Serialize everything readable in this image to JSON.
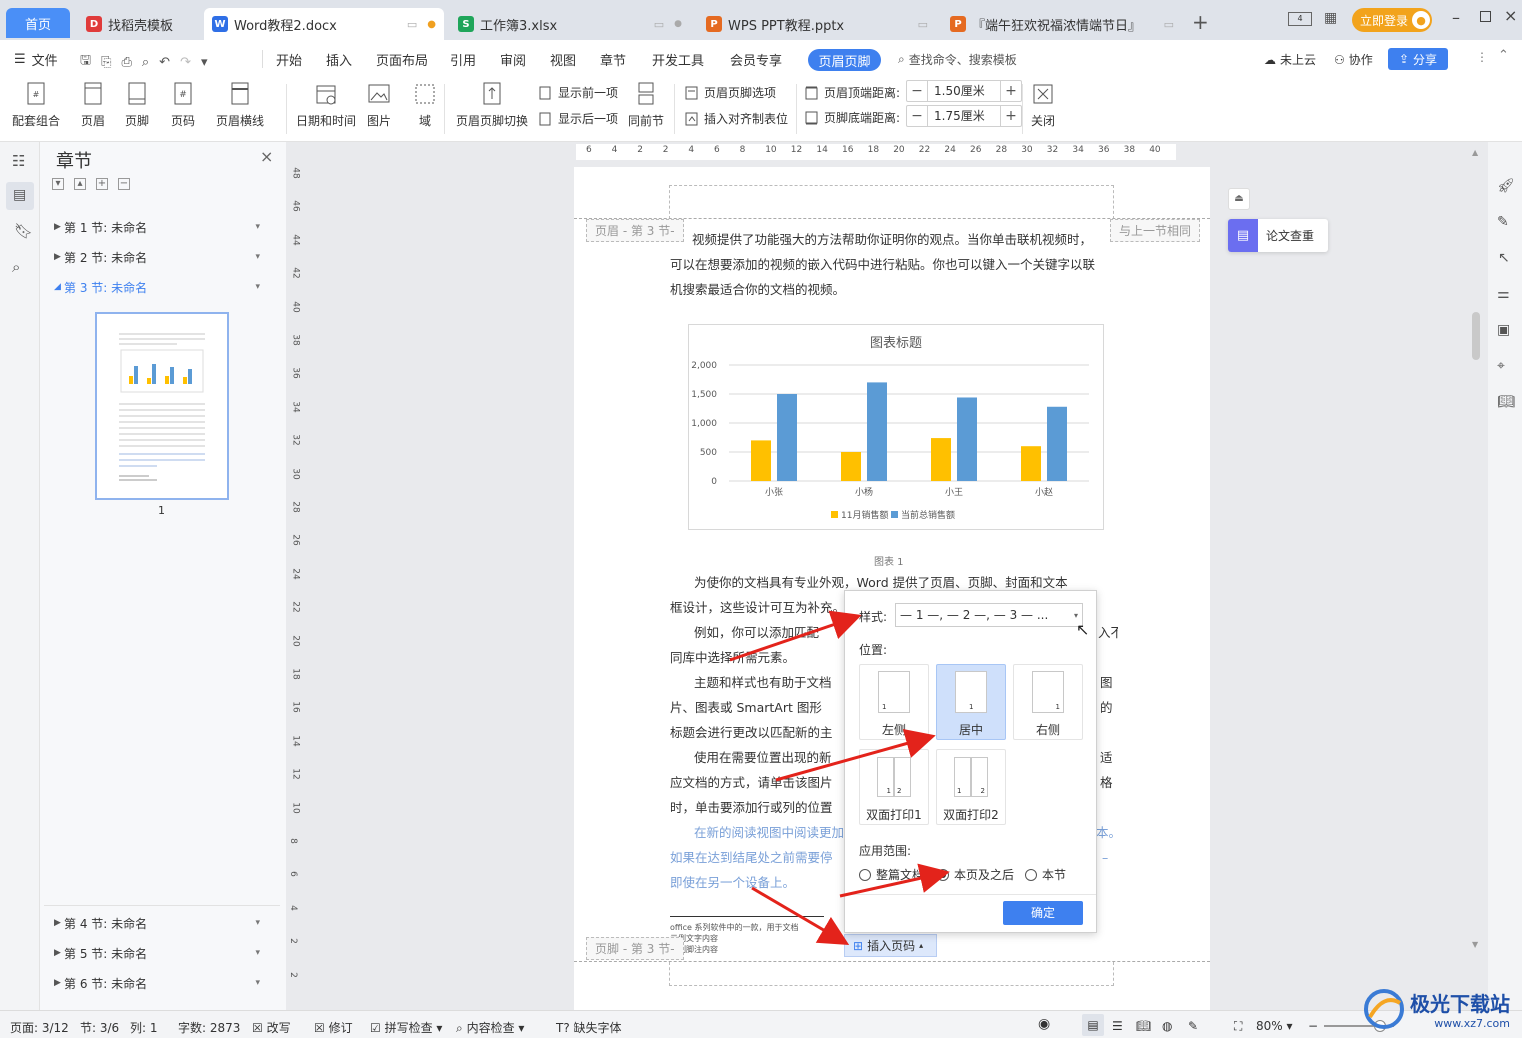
{
  "tabs": {
    "home": "首页",
    "items": [
      {
        "label": "找稻壳模板",
        "icon_color": "#e03b3b",
        "icon": "D"
      },
      {
        "label": "Word教程2.docx",
        "icon_color": "#2f6fe6",
        "icon": "W"
      },
      {
        "label": "工作簿3.xlsx",
        "icon_color": "#1fa55a",
        "icon": "S"
      },
      {
        "label": "WPS PPT教程.pptx",
        "icon_color": "#e56a21",
        "icon": "P"
      },
      {
        "label": "『端午狂欢祝福浓情端节日』",
        "icon_color": "#e56a21",
        "icon": "P"
      }
    ],
    "login": "立即登录"
  },
  "menu": {
    "file": "文件",
    "items": [
      "开始",
      "插入",
      "页面布局",
      "引用",
      "审阅",
      "视图",
      "章节",
      "开发工具",
      "会员专享"
    ],
    "active": "页眉页脚",
    "search": "查找命令、搜索模板",
    "cloud": "未上云",
    "collab": "协作",
    "share": "分享"
  },
  "ribbon": {
    "combo": "配套组合",
    "header": "页眉",
    "footer": "页脚",
    "page_number": "页码",
    "header_line": "页眉横线",
    "datetime": "日期和时间",
    "picture": "图片",
    "field": "域",
    "switch": "页眉页脚切换",
    "show_prev": "显示前一项",
    "show_next": "显示后一项",
    "same_prev": "同前节",
    "options": "页眉页脚选项",
    "insert_tab": "插入对齐制表位",
    "top_dist_label": "页眉顶端距离:",
    "top_dist": "1.50厘米",
    "bottom_dist_label": "页脚底端距离:",
    "bottom_dist": "1.75厘米",
    "close": "关闭"
  },
  "chapter_pane": {
    "title": "章节",
    "sections": [
      "第 1 节: 未命名",
      "第 2 节: 未命名",
      "第 3 节: 未命名",
      "第 4 节: 未命名",
      "第 5 节: 未命名",
      "第 6 节: 未命名"
    ],
    "thumb_page": "1"
  },
  "ruler": {
    "h_ticks": [
      "6",
      "4",
      "2",
      "2",
      "4",
      "6",
      "8",
      "10",
      "12",
      "14",
      "16",
      "18",
      "20",
      "22",
      "24",
      "26",
      "28",
      "30",
      "32",
      "34",
      "36",
      "38",
      "40"
    ],
    "v_ticks": [
      "48",
      "46",
      "44",
      "42",
      "40",
      "38",
      "36",
      "34",
      "32",
      "30",
      "28",
      "26",
      "24",
      "22",
      "20",
      "18",
      "16",
      "14",
      "12",
      "10",
      "8",
      "6",
      "4",
      "2",
      "2"
    ]
  },
  "document": {
    "header_label": "页眉 - 第 3 节-",
    "same_as_prev": "与上一节相同",
    "footer_label": "页脚 - 第 3 节-",
    "lines_top": [
      "视频提供了功能强大的方法帮助你证明你的观点。当你单击联机视频时，",
      "可以在想要添加的视频的嵌入代码中进行粘贴。你也可以键入一个关键字以联",
      "机搜索最适合你的文档的视频。"
    ],
    "caption": "图表 1",
    "lines_mid": [
      "为使你的文档具有专业外观，Word 提供了页眉、页脚、封面和文本",
      "框设计，这些设计可互为补充。",
      "例如，你可以添加匹配",
      "同库中选择所需元素。",
      "主题和样式也有助于文档",
      "片、图表或 SmartArt 图形",
      "标题会进行更改以匹配新的主",
      "使用在需要位置出现的新",
      "应文档的方式，请单击该图片",
      "时，单击要添加行或列的位置"
    ],
    "lines_blue": [
      "在新的阅读视图中阅读更加",
      "如果在达到结尾处之前需要停",
      "即使在另一个设备上。"
    ],
    "right_frag": [
      "入不",
      "图",
      "的",
      "适",
      "格",
      "本。",
      "–"
    ],
    "footnote": [
      "office 系列软件中的一款，用于文档",
      "示例文字内容",
      "示例脚注内容"
    ],
    "insert_page_number": "插入页码"
  },
  "chart_data": {
    "type": "bar",
    "title": "图表标题",
    "categories": [
      "小张",
      "小杨",
      "小王",
      "小赵"
    ],
    "series": [
      {
        "name": "11月销售额",
        "color": "#ffc000",
        "values": [
          700,
          500,
          740,
          600
        ]
      },
      {
        "name": "当前总销售额",
        "color": "#5b9bd5",
        "values": [
          1500,
          1700,
          1440,
          1280
        ]
      }
    ],
    "ylim": [
      0,
      2000
    ],
    "yticks": [
      "0",
      "500",
      "1,000",
      "1,500",
      "2,000"
    ],
    "legend_position": "bottom",
    "grid": true
  },
  "popup": {
    "style_label": "样式:",
    "style_value": "— 1 —, — 2 —, — 3 — ...",
    "position_label": "位置:",
    "positions": [
      "左侧",
      "居中",
      "右侧",
      "双面打印1",
      "双面打印2"
    ],
    "selected_position": "居中",
    "scope_label": "应用范围:",
    "scopes": [
      "整篇文档",
      "本页及之后",
      "本节"
    ],
    "selected_scope": "本页及之后",
    "ok": "确定"
  },
  "side_card": {
    "label": "论文查重"
  },
  "status": {
    "page": "页面: 3/12",
    "section": "节: 3/6",
    "col": "列: 1",
    "words": "字数: 2873",
    "rewrite": "改写",
    "revise": "修订",
    "spell": "拼写检查",
    "content": "内容检查",
    "missing_font": "缺失字体",
    "zoom": "80%"
  },
  "watermark": {
    "name": "极光下载站",
    "url": "www.xz7.com"
  }
}
